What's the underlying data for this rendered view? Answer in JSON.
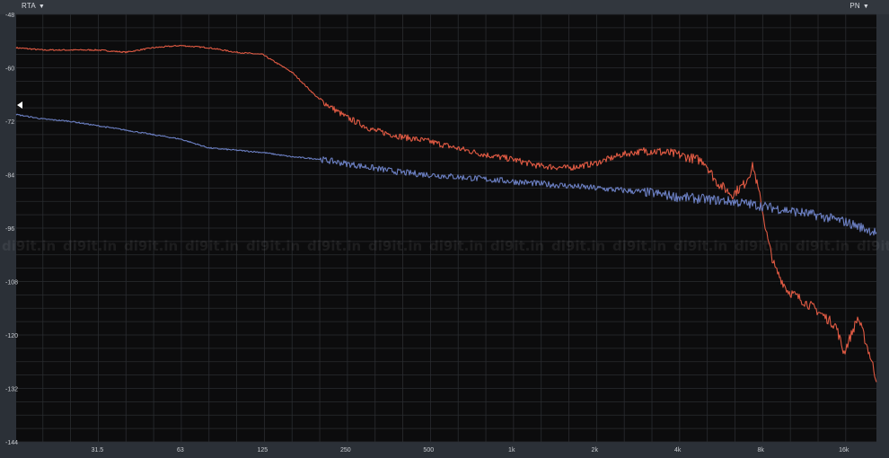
{
  "controls": {
    "left_dropdown": "RTA",
    "right_dropdown": "PN",
    "caret": "▼"
  },
  "watermark": "di9it.in",
  "colors": {
    "background": "#0c0c0d",
    "frame": "#2b3037",
    "grid": "#2a2c30",
    "series_red": "#e05a43",
    "series_blue": "#6b7fc2"
  },
  "chart_data": {
    "type": "line",
    "x_scale": "log",
    "y_tick_labels": [
      "-48",
      "-60",
      "-72",
      "-84",
      "-96",
      "-108",
      "-120",
      "-132",
      "-144"
    ],
    "y_ticks": [
      -48,
      -60,
      -72,
      -84,
      -96,
      -108,
      -120,
      -132,
      -144
    ],
    "ylim": [
      -144,
      -48
    ],
    "x_tick_labels": [
      "31.5",
      "63",
      "125",
      "250",
      "500",
      "1k",
      "2k",
      "4k",
      "8k",
      "16k"
    ],
    "x_ticks": [
      31.5,
      63,
      125,
      250,
      500,
      1000,
      2000,
      4000,
      8000,
      16000
    ],
    "xlim": [
      16,
      21000
    ],
    "grid": true,
    "series": [
      {
        "color": "#e05a43",
        "x": [
          16,
          20,
          25,
          31.5,
          40,
          50,
          63,
          80,
          100,
          125,
          160,
          200,
          250,
          315,
          400,
          500,
          630,
          800,
          1000,
          1250,
          1600,
          2000,
          2500,
          3150,
          4000,
          5000,
          5500,
          6300,
          7000,
          7500,
          8000,
          8500,
          9000,
          10000,
          12500,
          15000,
          16000,
          17000,
          18000,
          20000,
          21000
        ],
        "y": [
          -55.5,
          -56,
          -56,
          -56,
          -56.5,
          -55.5,
          -55,
          -55.5,
          -56.5,
          -57,
          -61,
          -67,
          -71,
          -74,
          -75.5,
          -76.5,
          -78,
          -79.5,
          -80.5,
          -82,
          -82.5,
          -81.5,
          -79.5,
          -78.5,
          -79.5,
          -81,
          -85.5,
          -88.5,
          -86,
          -82,
          -90,
          -99,
          -105,
          -110,
          -114,
          -118,
          -124,
          -120,
          -116,
          -125,
          -130
        ]
      },
      {
        "color": "#6b7fc2",
        "x": [
          16,
          20,
          25,
          31.5,
          40,
          50,
          63,
          80,
          100,
          125,
          160,
          200,
          250,
          315,
          400,
          500,
          630,
          800,
          1000,
          1250,
          1600,
          2000,
          2500,
          3150,
          4000,
          5000,
          6300,
          8000,
          10000,
          12500,
          16000,
          21000
        ],
        "y": [
          -70.5,
          -71.5,
          -72,
          -73,
          -74,
          -75,
          -76,
          -78,
          -78.5,
          -79,
          -80,
          -80.5,
          -81.5,
          -82.5,
          -83.5,
          -84,
          -84.5,
          -85,
          -85.5,
          -86,
          -86.5,
          -87,
          -87.5,
          -88,
          -89,
          -89.5,
          -90,
          -91,
          -92,
          -93,
          -94.5,
          -97
        ]
      }
    ]
  }
}
